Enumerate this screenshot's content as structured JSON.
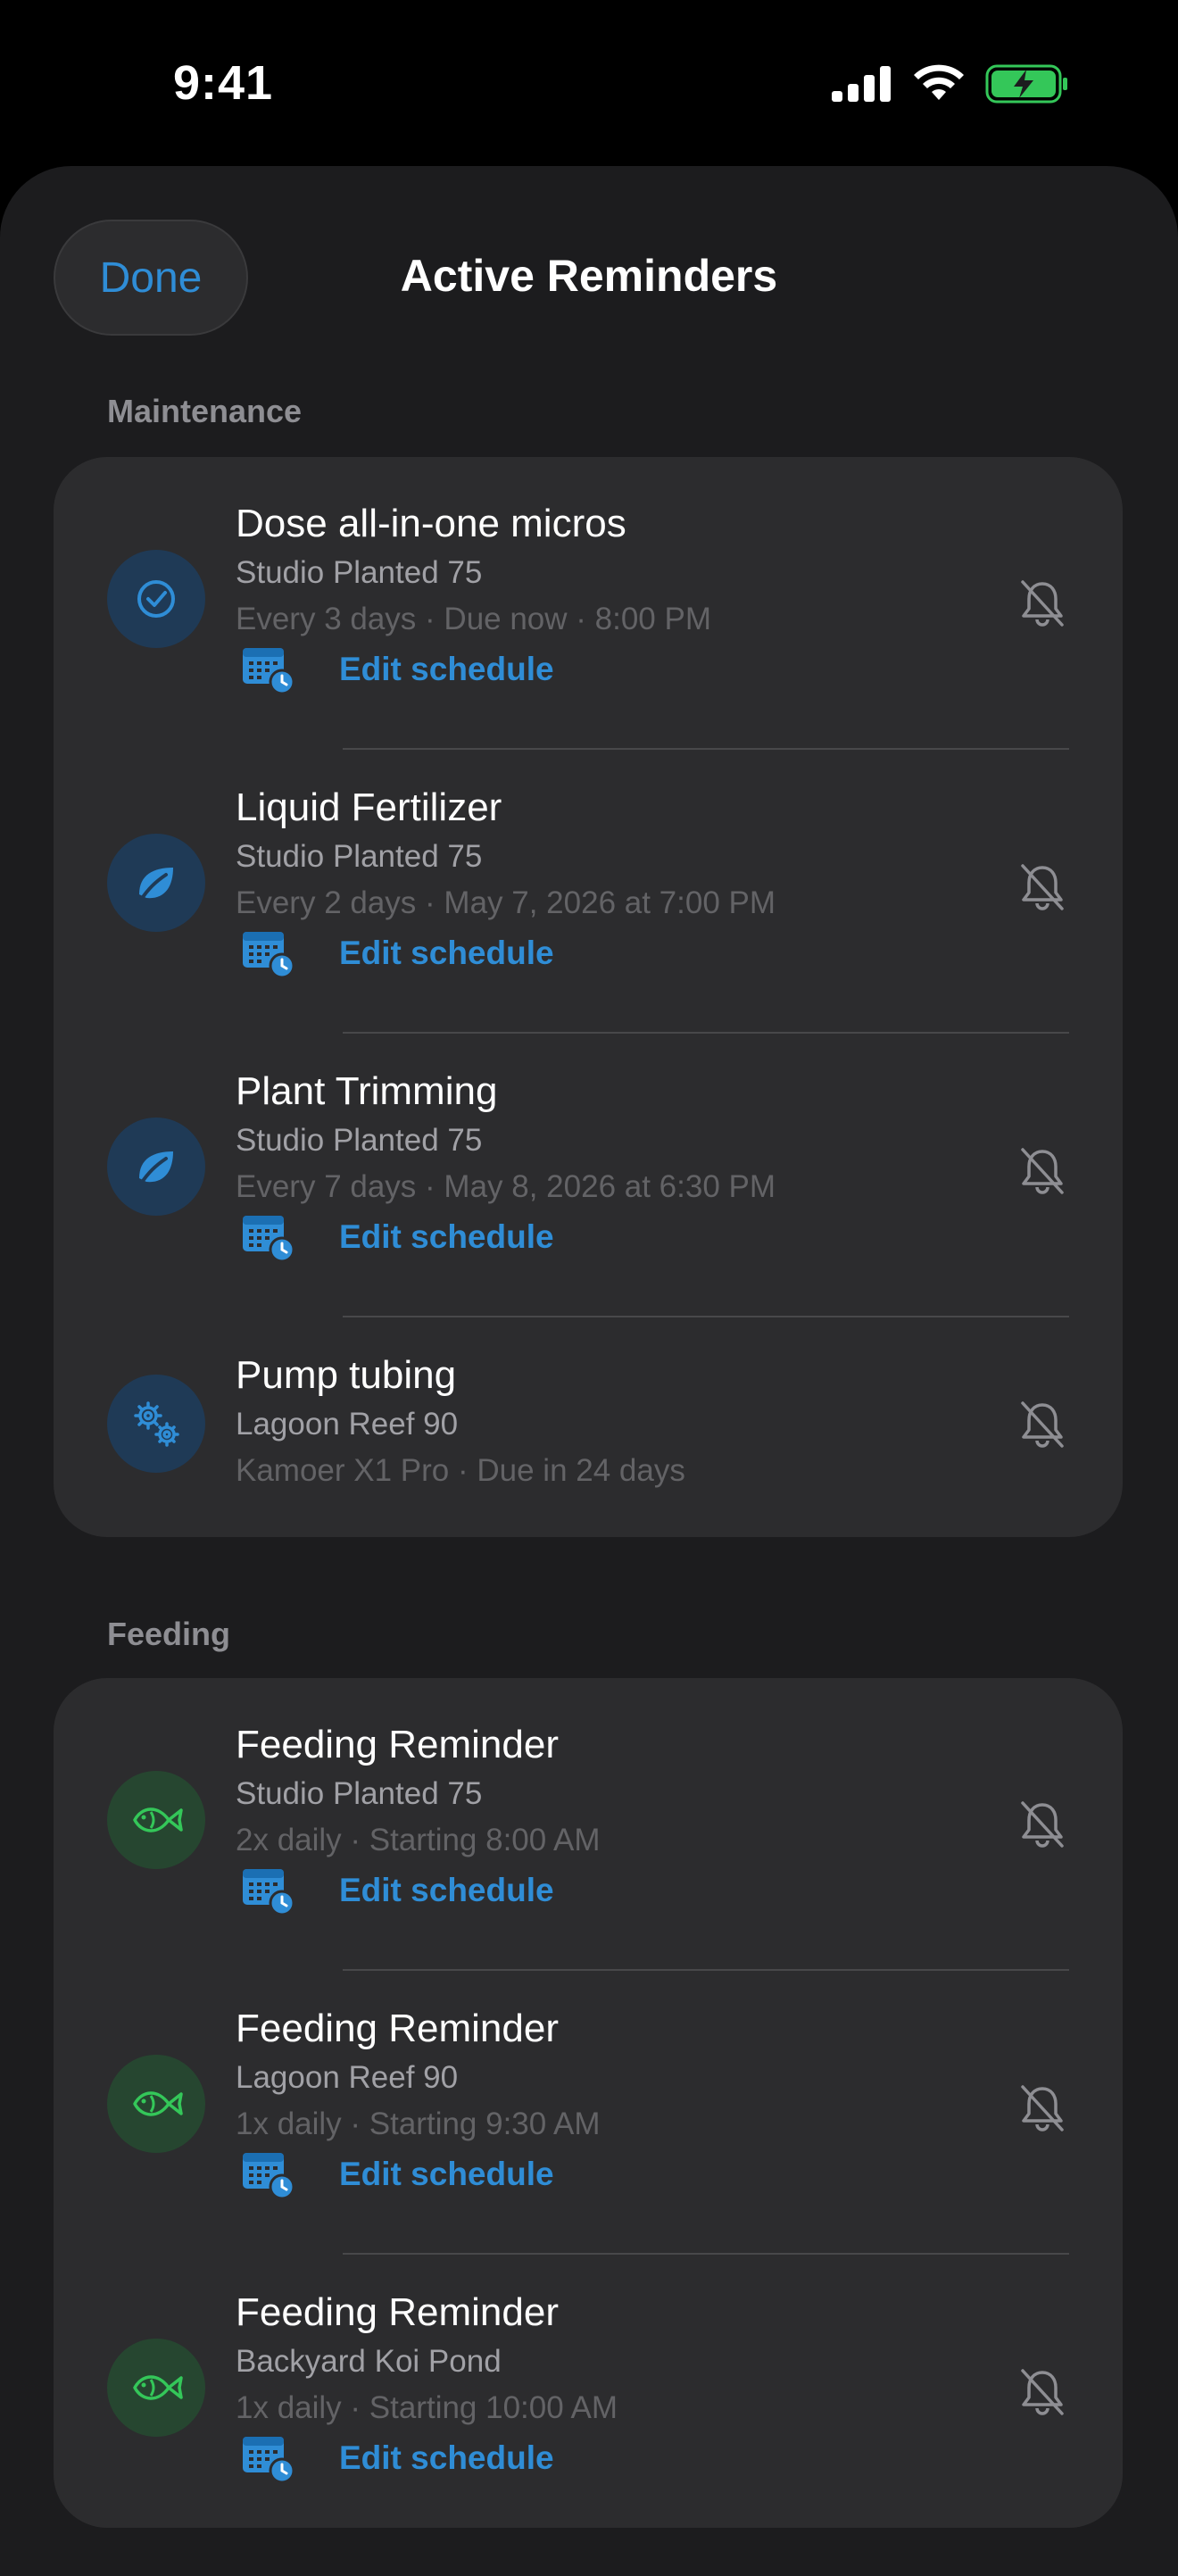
{
  "status": {
    "time": "9:41"
  },
  "header": {
    "done_label": "Done",
    "title": "Active Reminders"
  },
  "sections": [
    {
      "title": "Maintenance",
      "items": [
        {
          "title": "Dose all-in-one micros",
          "tank": "Studio Planted 75",
          "detail": "Every 3 days · Due now · 8:00 PM",
          "edit_label": "Edit schedule",
          "icon": "checkmark-circle-icon"
        },
        {
          "title": "Liquid Fertilizer",
          "tank": "Studio Planted 75",
          "detail": "Every 2 days · May 7, 2026 at 7:00 PM",
          "edit_label": "Edit schedule",
          "icon": "leaf-icon"
        },
        {
          "title": "Plant Trimming",
          "tank": "Studio Planted 75",
          "detail": "Every 7 days · May 8, 2026 at 6:30 PM",
          "edit_label": "Edit schedule",
          "icon": "leaf-icon"
        },
        {
          "title": "Pump tubing",
          "tank": "Lagoon Reef 90",
          "detail": "Kamoer X1 Pro · Due in 24 days",
          "icon": "gears-icon"
        }
      ]
    },
    {
      "title": "Feeding",
      "items": [
        {
          "title": "Feeding Reminder",
          "tank": "Studio Planted 75",
          "detail": "2x daily · Starting 8:00 AM",
          "edit_label": "Edit schedule",
          "icon": "fish-icon"
        },
        {
          "title": "Feeding Reminder",
          "tank": "Lagoon Reef 90",
          "detail": "1x daily · Starting 9:30 AM",
          "edit_label": "Edit schedule",
          "icon": "fish-icon"
        },
        {
          "title": "Feeding Reminder",
          "tank": "Backyard Koi Pond",
          "detail": "1x daily · Starting 10:00 AM",
          "edit_label": "Edit schedule",
          "icon": "fish-icon"
        }
      ]
    }
  ],
  "colors": {
    "accent": "#2f8dd6",
    "feeding": "#34c759",
    "background": "#1c1c1e",
    "card": "#2c2c2e"
  }
}
